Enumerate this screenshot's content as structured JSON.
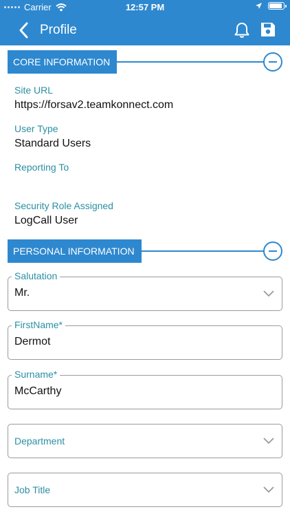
{
  "status_bar": {
    "carrier": "Carrier",
    "time": "12:57 PM"
  },
  "navbar": {
    "title": "Profile"
  },
  "core_section": {
    "title": "CORE INFORMATION",
    "fields": [
      {
        "label": "Site URL",
        "value": "https://forsav2.teamkonnect.com"
      },
      {
        "label": "User Type",
        "value": "Standard Users"
      },
      {
        "label": "Reporting To",
        "value": ""
      },
      {
        "label": "Security Role Assigned",
        "value": "LogCall User"
      }
    ]
  },
  "personal_section": {
    "title": "PERSONAL INFORMATION",
    "fields": [
      {
        "label": "Salutation",
        "value": "Mr.",
        "type": "dropdown"
      },
      {
        "label": "FirstName*",
        "value": "Dermot",
        "type": "text"
      },
      {
        "label": "Surname*",
        "value": "McCarthy",
        "type": "text"
      },
      {
        "label": "Department",
        "value": "",
        "type": "dropdown"
      },
      {
        "label": "Job Title",
        "value": "",
        "type": "dropdown"
      }
    ]
  },
  "colors": {
    "brand": "#2e88cf",
    "label": "#2a8fa4",
    "border": "#9a9a9a"
  }
}
